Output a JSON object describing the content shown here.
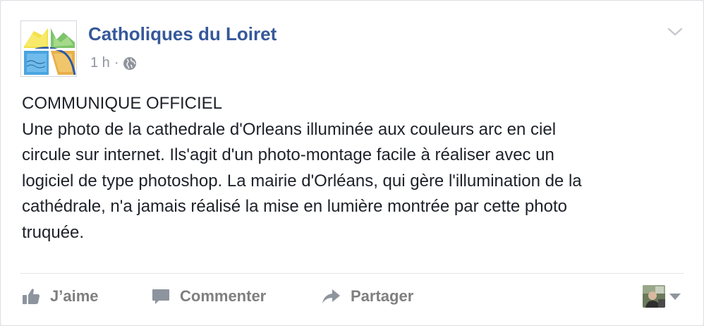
{
  "post": {
    "page_name": "Catholiques du Loiret",
    "timestamp": "1 h",
    "separator": "·",
    "privacy_icon": "globe-icon",
    "menu_icon": "chevron-down-icon",
    "text": {
      "line1": "COMMUNIQUE OFFICIEL",
      "body": "Une photo de la cathedrale d'Orleans illuminée aux couleurs arc en ciel\ncircule sur internet. Ils'agit d'un photo-montage facile à réaliser avec un\nlogiciel de type photoshop. La mairie d'Orléans, qui gère l'illumination de la\ncathédrale, n'a jamais réalisé la mise en lumière montrée par cette photo\ntruquée."
    }
  },
  "actions": {
    "like_label": "J’aime",
    "comment_label": "Commenter",
    "share_label": "Partager",
    "like_icon": "thumbs-up-icon",
    "comment_icon": "speech-bubble-icon",
    "share_icon": "share-arrow-icon"
  },
  "colors": {
    "link": "#365899",
    "text": "#1d2129",
    "meta": "#90949c",
    "action": "#7f7f7f"
  }
}
